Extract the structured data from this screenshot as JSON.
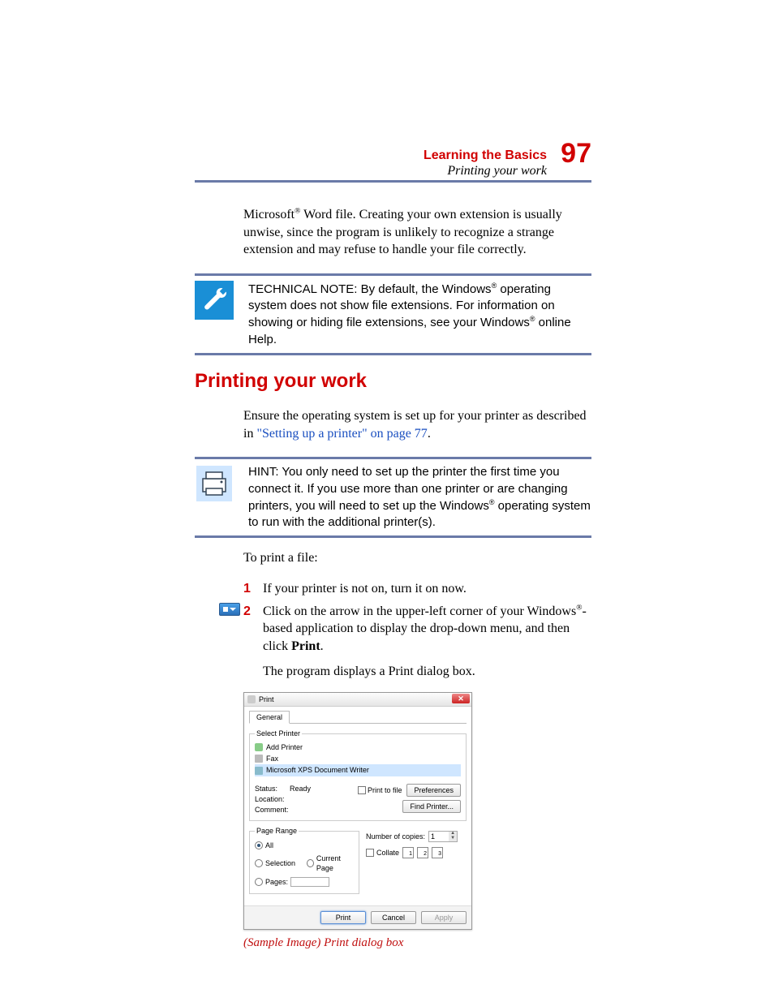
{
  "header": {
    "chapter": "Learning the Basics",
    "section_italic": "Printing your work",
    "page_number": "97"
  },
  "intro_paragraph": {
    "pre": "Microsoft",
    "reg1": "®",
    "post": " Word file. Creating your own extension is usually unwise, since the program is unlikely to recognize a strange extension and may refuse to handle your file correctly."
  },
  "tech_note": {
    "label": "TECHNICAL NOTE:",
    "t1": " By default, the Windows",
    "reg1": "®",
    "t2": " operating system does not show file extensions. For information on showing or hiding file extensions, see your Windows",
    "reg2": "®",
    "t3": " online Help."
  },
  "heading": "Printing your work",
  "ensure_para": {
    "t1": "Ensure the operating system is set up for your printer as described in ",
    "link": "\"Setting up a printer\" on page 77",
    "t2": "."
  },
  "hint": {
    "label": "HINT:",
    "t1": " You only need to set up the printer the first time you connect it. If you use more than one printer or are changing printers, you will need to set up the Windows",
    "reg1": "®",
    "t2": " operating system to run with the additional printer(s)."
  },
  "to_print": "To print a file:",
  "step1": {
    "num": "1",
    "text": "If your printer is not on, turn it on now."
  },
  "step2": {
    "num": "2",
    "t1": "Click on the arrow in the upper-left corner of your Windows",
    "reg": "®",
    "t2": "-based application to display the drop-down menu, and then click ",
    "bold": "Print",
    "t3": "."
  },
  "step2_after": "The program displays a Print dialog box.",
  "dialog": {
    "title": "Print",
    "tab_general": "General",
    "grp_select": "Select Printer",
    "printers": {
      "add": "Add Printer",
      "fax": "Fax",
      "xps": "Microsoft XPS Document Writer"
    },
    "status_label": "Status:",
    "status_value": "Ready",
    "location_label": "Location:",
    "comment_label": "Comment:",
    "print_to_file": "Print to file",
    "preferences": "Preferences",
    "find_printer": "Find Printer...",
    "grp_range": "Page Range",
    "all": "All",
    "selection": "Selection",
    "current_page": "Current Page",
    "pages": "Pages:",
    "copies_label": "Number of copies:",
    "copies_value": "1",
    "collate": "Collate",
    "collate_n": {
      "a": "1",
      "b": "2",
      "c": "3"
    },
    "btn_print": "Print",
    "btn_cancel": "Cancel",
    "btn_apply": "Apply"
  },
  "caption": "(Sample Image) Print dialog box"
}
